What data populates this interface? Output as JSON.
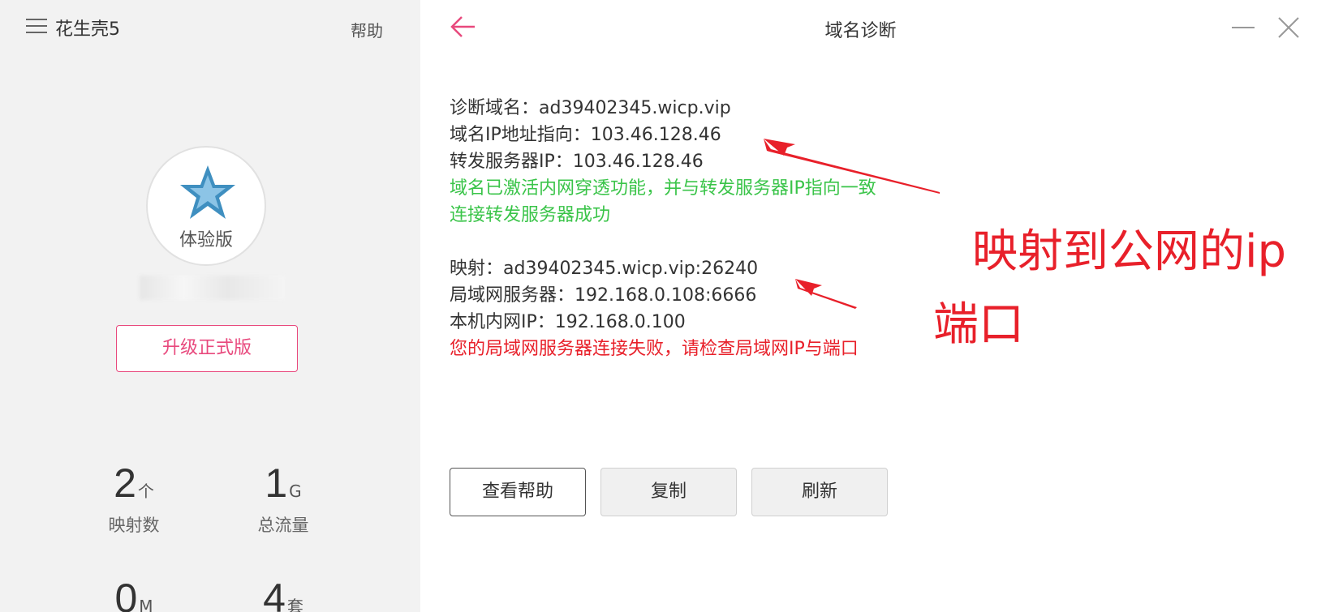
{
  "sidebar": {
    "app_title": "花生壳5",
    "help_label": "帮助",
    "avatar_label": "体验版",
    "upgrade_label": "升级正式版",
    "stats": [
      {
        "value": "2",
        "unit": "个",
        "label": "映射数"
      },
      {
        "value": "1",
        "unit": "G",
        "label": "总流量"
      },
      {
        "value": "0",
        "unit": "M",
        "label": ""
      },
      {
        "value": "4",
        "unit": "套",
        "label": ""
      }
    ]
  },
  "header": {
    "title": "域名诊断"
  },
  "diagnosis": {
    "domain_line": "诊断域名：ad39402345.wicp.vip",
    "ip_line": "域名IP地址指向：103.46.128.46",
    "server_ip_line": "转发服务器IP：103.46.128.46",
    "activated_msg": "域名已激活内网穿透功能，并与转发服务器IP指向一致",
    "connected_msg": "连接转发服务器成功",
    "mapping_line": "映射：ad39402345.wicp.vip:26240",
    "lan_server_line": "局域网服务器：192.168.0.108:6666",
    "local_ip_line": "本机内网IP：192.168.0.100",
    "error_msg": "您的局域网服务器连接失败，请检查局域网IP与端口"
  },
  "buttons": {
    "help": "查看帮助",
    "copy": "复制",
    "refresh": "刷新"
  },
  "annotation": {
    "line1": "映射到公网的ip",
    "line2": "端口"
  },
  "colors": {
    "accent": "#e8497d",
    "success": "#3ac449",
    "error": "#e8202a",
    "annotation": "#e8202a"
  }
}
